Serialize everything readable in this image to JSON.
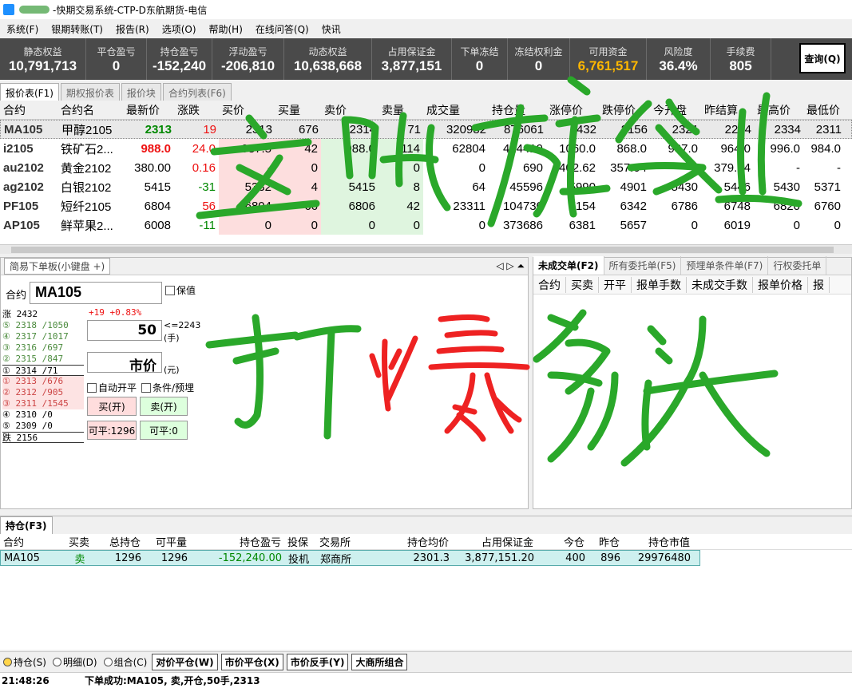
{
  "window": {
    "title": "-快期交易系统-CTP-D东航期货-电信"
  },
  "menu": [
    "系统(F)",
    "银期转账(T)",
    "报告(R)",
    "选项(O)",
    "帮助(H)",
    "在线问答(Q)",
    "快讯"
  ],
  "summary": [
    {
      "label": "静态权益",
      "value": "10,791,713",
      "w": 108
    },
    {
      "label": "平仓盈亏",
      "value": "0",
      "w": 76
    },
    {
      "label": "持仓盈亏",
      "value": "-152,240",
      "w": 82
    },
    {
      "label": "浮动盈亏",
      "value": "-206,810",
      "w": 90
    },
    {
      "label": "动态权益",
      "value": "10,638,668",
      "w": 110
    },
    {
      "label": "占用保证金",
      "value": "3,877,151",
      "w": 100
    },
    {
      "label": "下单冻结",
      "value": "0",
      "w": 70
    },
    {
      "label": "冻结权利金",
      "value": "0",
      "w": 78
    },
    {
      "label": "可用资金",
      "value": "6,761,517",
      "w": 96
    },
    {
      "label": "风险度",
      "value": "36.4%",
      "w": 80
    },
    {
      "label": "手续费",
      "value": "805",
      "w": 76
    }
  ],
  "query_button": "查询(Q)",
  "quote_tabs": [
    "报价表(F1)",
    "期权报价表",
    "报价块",
    "合约列表(F6)"
  ],
  "quote_headers": [
    "合约",
    "合约名",
    "最新价",
    "涨跌",
    "买价",
    "买量",
    "卖价",
    "卖量",
    "成交量",
    "持仓量",
    "涨停价",
    "跌停价",
    "今开盘",
    "昨结算",
    "最高价",
    "最低价"
  ],
  "quote_rows": [
    {
      "cells": [
        "MA105",
        "甲醇2105",
        "2313",
        "19",
        "2313",
        "676",
        "2314",
        "71",
        "320982",
        "876061",
        "2432",
        "2156",
        "2321",
        "2294",
        "2334",
        "2311"
      ],
      "last_class": "green bold",
      "chg_class": "red"
    },
    {
      "cells": [
        "i2105",
        "铁矿石2...",
        "988.0",
        "24.0",
        "987.5",
        "42",
        "988.0",
        "114",
        "62804",
        "424419",
        "1060.0",
        "868.0",
        "987.0",
        "964.0",
        "996.0",
        "984.0"
      ],
      "last_class": "red bold",
      "chg_class": "red"
    },
    {
      "cells": [
        "au2102",
        "黄金2102",
        "380.00",
        "0.16",
        "-",
        "0",
        "-",
        "0",
        "0",
        "690",
        "402.62",
        "357.04",
        "-",
        "379.84",
        "-",
        "-"
      ],
      "last_class": "",
      "chg_class": "red"
    },
    {
      "cells": [
        "ag2102",
        "白银2102",
        "5415",
        "-31",
        "5332",
        "4",
        "5415",
        "8",
        "64",
        "45596",
        "5990",
        "4901",
        "5430",
        "5446",
        "5430",
        "5371"
      ],
      "last_class": "",
      "chg_class": "green"
    },
    {
      "cells": [
        "PF105",
        "短纤2105",
        "6804",
        "56",
        "6804",
        "66",
        "6806",
        "42",
        "23311",
        "104730",
        "7154",
        "6342",
        "6786",
        "6748",
        "6820",
        "6760"
      ],
      "last_class": "",
      "chg_class": "red"
    },
    {
      "cells": [
        "AP105",
        "鲜苹果2...",
        "6008",
        "-11",
        "0",
        "0",
        "0",
        "0",
        "0",
        "373686",
        "6381",
        "5657",
        "0",
        "6019",
        "0",
        "0"
      ],
      "last_class": "",
      "chg_class": "green"
    }
  ],
  "order_panel": {
    "tab": "简易下单板(小键盘 +)",
    "symbol_label": "合约",
    "symbol": "MA105",
    "hedge_label": "保值",
    "change": "+19 +0.83%",
    "qty": "50",
    "qty_limit": "<=2243",
    "qty_unit": "(手)",
    "price": "市价",
    "price_unit": "(元)",
    "auto_label": "自动开平",
    "cond_label": "条件/预埋",
    "buy_label": "买(开)",
    "sell_label": "卖(开)",
    "close_buy_label": "可平:1296",
    "close_sell_label": "可平:0",
    "ladder": [
      {
        "text": "涨 2432",
        "cls": ""
      },
      {
        "text": "⑤ 2318 /1050",
        "cls": "bidside"
      },
      {
        "text": "④ 2317 /1017",
        "cls": "bidside"
      },
      {
        "text": "③ 2316 /697",
        "cls": "bidside"
      },
      {
        "text": "② 2315 /847",
        "cls": "bidside"
      },
      {
        "text": "① 2314 /71",
        "cls": "sep"
      },
      {
        "text": "① 2313 /676",
        "cls": "askside"
      },
      {
        "text": "② 2312 /905",
        "cls": "askside"
      },
      {
        "text": "③ 2311 /1545",
        "cls": "askside"
      },
      {
        "text": "④ 2310 /0",
        "cls": ""
      },
      {
        "text": "⑤ 2309 /0",
        "cls": ""
      },
      {
        "text": "跌 2156",
        "cls": "sep"
      }
    ]
  },
  "right_panel": {
    "tabs": [
      "未成交单(F2)",
      "所有委托单(F5)",
      "预埋单条件单(F7)",
      "行权委托单"
    ],
    "headers": [
      "合约",
      "买卖",
      "开平",
      "报单手数",
      "未成交手数",
      "报单价格",
      "报"
    ]
  },
  "positions": {
    "tab": "持仓(F3)",
    "headers": [
      "合约",
      "买卖",
      "总持仓",
      "可平量",
      "持仓盈亏",
      "投保",
      "交易所",
      "持仓均价",
      "占用保证金",
      "今仓",
      "昨仓",
      "持仓市值"
    ],
    "row": [
      "MA105",
      "卖",
      "1296",
      "1296",
      "-152,240.00",
      "投机",
      "郑商所",
      "2301.3",
      "3,877,151.20",
      "400",
      "896",
      "29976480"
    ]
  },
  "bottom": {
    "radios": [
      "持仓(S)",
      "明细(D)",
      "组合(C)"
    ],
    "buttons": [
      "对价平仓(W)",
      "市价平仓(X)",
      "市价反手(Y)",
      "大商所组合"
    ]
  },
  "status": {
    "time": "21:48:26",
    "message": "下单成功:MA105,  卖,开仓,50手,2313"
  },
  "overlay_text": {
    "top": "立账为证",
    "middle": "打爆多头"
  },
  "colors": {
    "gold": "#ffb700",
    "green_ink": "#2aa82a",
    "red_ink": "#e22"
  }
}
